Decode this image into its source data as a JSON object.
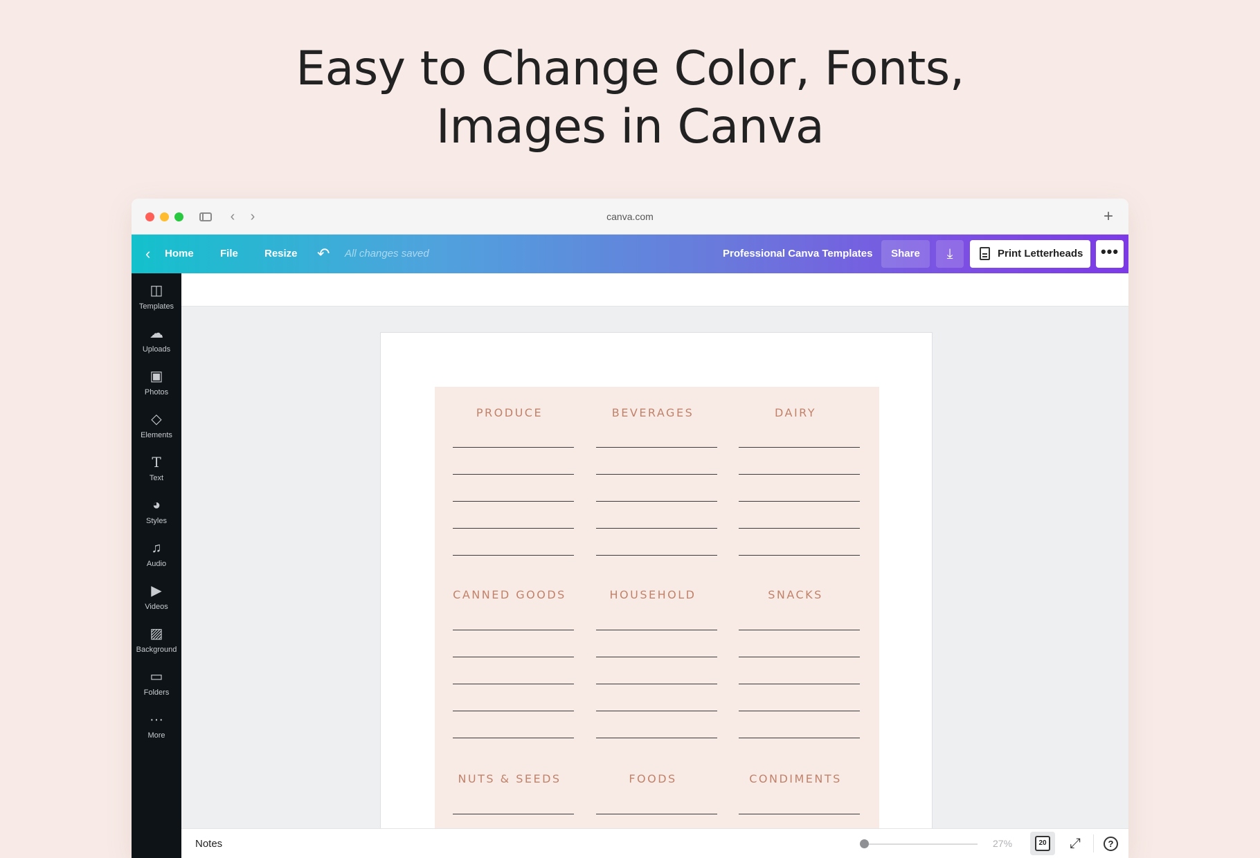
{
  "headline": {
    "line1": "Easy to Change Color, Fonts,",
    "line2": "Images in Canva"
  },
  "browser": {
    "url": "canva.com",
    "new_tab_icon": "plus-icon"
  },
  "toolbar": {
    "home": "Home",
    "file": "File",
    "resize": "Resize",
    "saved_status": "All changes saved",
    "doc_title": "Professional Canva Templates",
    "share": "Share",
    "print": "Print Letterheads",
    "more": "•••"
  },
  "sidebar": {
    "items": [
      {
        "label": "Templates",
        "icon": "templates-icon"
      },
      {
        "label": "Uploads",
        "icon": "upload-cloud-icon"
      },
      {
        "label": "Photos",
        "icon": "photos-icon"
      },
      {
        "label": "Elements",
        "icon": "elements-icon"
      },
      {
        "label": "Text",
        "icon": "text-icon"
      },
      {
        "label": "Styles",
        "icon": "palette-icon"
      },
      {
        "label": "Audio",
        "icon": "music-note-icon"
      },
      {
        "label": "Videos",
        "icon": "video-icon"
      },
      {
        "label": "Background",
        "icon": "background-hatch-icon"
      },
      {
        "label": "Folders",
        "icon": "folder-icon"
      },
      {
        "label": "More",
        "icon": "more-dots-icon"
      }
    ]
  },
  "planner": {
    "categories": [
      "PRODUCE",
      "BEVERAGES",
      "DAIRY",
      "CANNED GOODS",
      "HOUSEHOLD",
      "SNACKS",
      "NUTS & SEEDS",
      "FOODS",
      "CONDIMENTS"
    ]
  },
  "bottom": {
    "notes": "Notes",
    "zoom": "27%",
    "pages": "20"
  },
  "colors": {
    "planner_bg": "#f8ebe5",
    "category_text": "#c0826b",
    "sidebar_bg": "#0e1318",
    "page_bg": "#f8ebe7"
  }
}
